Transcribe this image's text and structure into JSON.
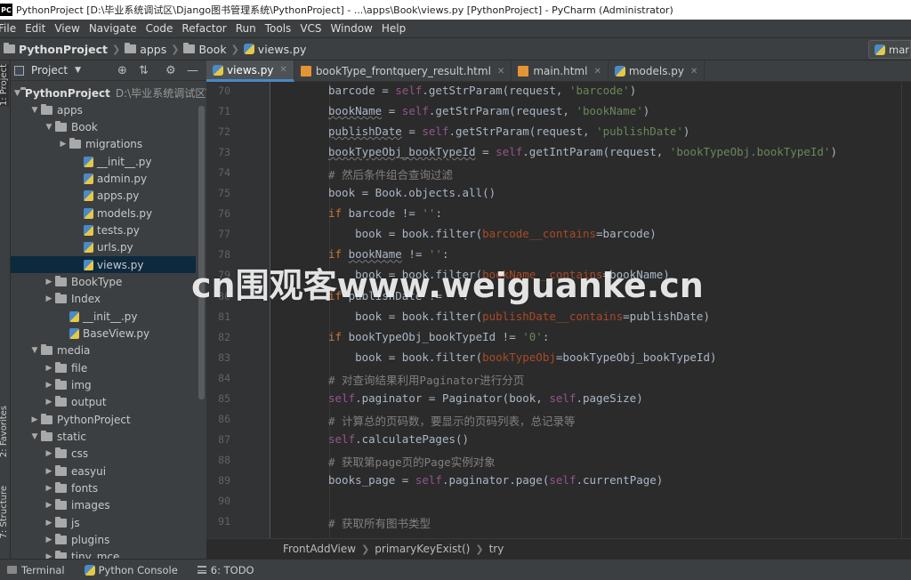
{
  "window": {
    "app_logo": "PC",
    "title": "PythonProject [D:\\毕业系统调试区\\Django图书管理系统\\PythonProject] - ...\\apps\\Book\\views.py [PythonProject] - PyCharm (Administrator)"
  },
  "menu": [
    "File",
    "Edit",
    "View",
    "Navigate",
    "Code",
    "Refactor",
    "Run",
    "Tools",
    "VCS",
    "Window",
    "Help"
  ],
  "navbar": {
    "crumbs": [
      "PythonProject",
      "apps",
      "Book",
      "views.py"
    ],
    "run_config": "mar"
  },
  "side_tabs": {
    "project": "1: Project",
    "favorites": "2: Favorites",
    "structure": "7: Structure"
  },
  "project_panel": {
    "title": "Project",
    "tree": [
      {
        "label": "PythonProject",
        "hint": "D:\\毕业系统调试区\\",
        "depth": 0,
        "arrow": "down",
        "icon": "folder",
        "bold": true
      },
      {
        "label": "apps",
        "depth": 1,
        "arrow": "down",
        "icon": "folder"
      },
      {
        "label": "Book",
        "depth": 2,
        "arrow": "down",
        "icon": "folder"
      },
      {
        "label": "migrations",
        "depth": 3,
        "arrow": "right",
        "icon": "folder"
      },
      {
        "label": "__init__.py",
        "depth": 4,
        "arrow": "",
        "icon": "py"
      },
      {
        "label": "admin.py",
        "depth": 4,
        "arrow": "",
        "icon": "py"
      },
      {
        "label": "apps.py",
        "depth": 4,
        "arrow": "",
        "icon": "py"
      },
      {
        "label": "models.py",
        "depth": 4,
        "arrow": "",
        "icon": "py"
      },
      {
        "label": "tests.py",
        "depth": 4,
        "arrow": "",
        "icon": "py"
      },
      {
        "label": "urls.py",
        "depth": 4,
        "arrow": "",
        "icon": "py"
      },
      {
        "label": "views.py",
        "depth": 4,
        "arrow": "",
        "icon": "py",
        "selected": true
      },
      {
        "label": "BookType",
        "depth": 2,
        "arrow": "right",
        "icon": "folder"
      },
      {
        "label": "Index",
        "depth": 2,
        "arrow": "right",
        "icon": "folder"
      },
      {
        "label": "__init__.py",
        "depth": 3,
        "arrow": "",
        "icon": "py"
      },
      {
        "label": "BaseView.py",
        "depth": 3,
        "arrow": "",
        "icon": "py"
      },
      {
        "label": "media",
        "depth": 1,
        "arrow": "down",
        "icon": "folder"
      },
      {
        "label": "file",
        "depth": 2,
        "arrow": "right",
        "icon": "folder"
      },
      {
        "label": "img",
        "depth": 2,
        "arrow": "right",
        "icon": "folder"
      },
      {
        "label": "output",
        "depth": 2,
        "arrow": "right",
        "icon": "folder"
      },
      {
        "label": "PythonProject",
        "depth": 1,
        "arrow": "right",
        "icon": "folder"
      },
      {
        "label": "static",
        "depth": 1,
        "arrow": "down",
        "icon": "folder"
      },
      {
        "label": "css",
        "depth": 2,
        "arrow": "right",
        "icon": "folder"
      },
      {
        "label": "easyui",
        "depth": 2,
        "arrow": "right",
        "icon": "folder"
      },
      {
        "label": "fonts",
        "depth": 2,
        "arrow": "right",
        "icon": "folder"
      },
      {
        "label": "images",
        "depth": 2,
        "arrow": "right",
        "icon": "folder"
      },
      {
        "label": "js",
        "depth": 2,
        "arrow": "right",
        "icon": "folder"
      },
      {
        "label": "plugins",
        "depth": 2,
        "arrow": "right",
        "icon": "folder"
      },
      {
        "label": "tiny_mce",
        "depth": 2,
        "arrow": "right",
        "icon": "folder"
      }
    ]
  },
  "tabs": [
    {
      "label": "views.py",
      "icon": "py",
      "active": true
    },
    {
      "label": "bookType_frontquery_result.html",
      "icon": "html",
      "active": false
    },
    {
      "label": "main.html",
      "icon": "html",
      "active": false
    },
    {
      "label": "models.py",
      "icon": "py",
      "active": false
    }
  ],
  "code_lines": [
    {
      "n": "70",
      "segs": [
        [
          "barcode = ",
          ""
        ],
        [
          "self",
          "sf"
        ],
        [
          ".getStrParam(request, ",
          ""
        ],
        [
          "'barcode'",
          "st"
        ],
        [
          ")",
          ""
        ]
      ]
    },
    {
      "n": "71",
      "segs": [
        [
          "bookName",
          "ul"
        ],
        [
          " = ",
          ""
        ],
        [
          "self",
          "sf"
        ],
        [
          ".getStrParam(request, ",
          ""
        ],
        [
          "'bookName'",
          "st"
        ],
        [
          ")",
          ""
        ]
      ]
    },
    {
      "n": "72",
      "segs": [
        [
          "publishDate",
          "ul"
        ],
        [
          " = ",
          ""
        ],
        [
          "self",
          "sf"
        ],
        [
          ".getStrParam(request, ",
          ""
        ],
        [
          "'publishDate'",
          "st"
        ],
        [
          ")",
          ""
        ]
      ]
    },
    {
      "n": "73",
      "segs": [
        [
          "bookTypeObj_bookTypeId",
          "ul"
        ],
        [
          " = ",
          ""
        ],
        [
          "self",
          "sf"
        ],
        [
          ".getIntParam(request, ",
          ""
        ],
        [
          "'bookTypeObj.bookTypeId'",
          "st"
        ],
        [
          ")",
          ""
        ]
      ]
    },
    {
      "n": "74",
      "segs": [
        [
          "# 然后条件组合查询过滤",
          "cm"
        ]
      ]
    },
    {
      "n": "75",
      "segs": [
        [
          "book = Book.objects.all()",
          ""
        ]
      ]
    },
    {
      "n": "76",
      "segs": [
        [
          "if ",
          "kw"
        ],
        [
          "barcode != ",
          ""
        ],
        [
          "''",
          "st"
        ],
        [
          ":",
          ""
        ]
      ]
    },
    {
      "n": "77",
      "segs": [
        [
          "    book = book.filter(",
          ""
        ],
        [
          "barcode__contains",
          "pa"
        ],
        [
          "=barcode)",
          ""
        ]
      ]
    },
    {
      "n": "78",
      "segs": [
        [
          "if ",
          "kw"
        ],
        [
          "bookName",
          "ul"
        ],
        [
          " != ",
          ""
        ],
        [
          "''",
          "st"
        ],
        [
          ":",
          ""
        ]
      ]
    },
    {
      "n": "79",
      "segs": [
        [
          "    book = book.filter(",
          ""
        ],
        [
          "bookName__contains",
          "pa"
        ],
        [
          "=bookName)",
          ""
        ]
      ]
    },
    {
      "n": "80",
      "segs": [
        [
          "if ",
          "kw"
        ],
        [
          "publishDate != ",
          ""
        ],
        [
          "''",
          "st"
        ],
        [
          ":",
          ""
        ]
      ]
    },
    {
      "n": "81",
      "segs": [
        [
          "    book = book.filter(",
          ""
        ],
        [
          "publishDate__contains",
          "pa"
        ],
        [
          "=publishDate)",
          ""
        ]
      ]
    },
    {
      "n": "82",
      "segs": [
        [
          "if ",
          "kw"
        ],
        [
          "bookTypeObj_bookTypeId != ",
          ""
        ],
        [
          "'0'",
          "st"
        ],
        [
          ":",
          ""
        ]
      ]
    },
    {
      "n": "83",
      "segs": [
        [
          "    book = book.filter(",
          ""
        ],
        [
          "bookTypeObj",
          "pa"
        ],
        [
          "=bookTypeObj_bookTypeId)",
          ""
        ]
      ]
    },
    {
      "n": "84",
      "segs": [
        [
          "# 对查询结果利用Paginator进行分页",
          "cm"
        ]
      ]
    },
    {
      "n": "85",
      "segs": [
        [
          "self",
          "sf"
        ],
        [
          ".paginator = Paginator(book, ",
          ""
        ],
        [
          "self",
          "sf"
        ],
        [
          ".pageSize)",
          ""
        ]
      ]
    },
    {
      "n": "86",
      "segs": [
        [
          "# 计算总的页码数，要显示的页码列表，总记录等",
          "cm"
        ]
      ]
    },
    {
      "n": "87",
      "segs": [
        [
          "self",
          "sf"
        ],
        [
          ".calculatePages()",
          ""
        ]
      ]
    },
    {
      "n": "88",
      "segs": [
        [
          "# 获取第page页的Page实例对象",
          "cm"
        ]
      ]
    },
    {
      "n": "89",
      "segs": [
        [
          "books_page = ",
          ""
        ],
        [
          "self",
          "sf"
        ],
        [
          ".paginator.page(",
          ""
        ],
        [
          "self",
          "sf"
        ],
        [
          ".currentPage)",
          ""
        ]
      ]
    },
    {
      "n": "90",
      "segs": []
    },
    {
      "n": "91",
      "segs": [
        [
          "# 获取所有图书类型",
          "cm"
        ]
      ]
    }
  ],
  "editor_breadcrumb": [
    "FrontAddView",
    "primaryKeyExist()",
    "try"
  ],
  "bottom_tools": [
    {
      "label": "Terminal",
      "icon": "terminal"
    },
    {
      "label": "Python Console",
      "icon": "py"
    },
    {
      "label": "6: TODO",
      "icon": "list"
    }
  ],
  "watermark": "cn围观客www.weiguanke.cn"
}
